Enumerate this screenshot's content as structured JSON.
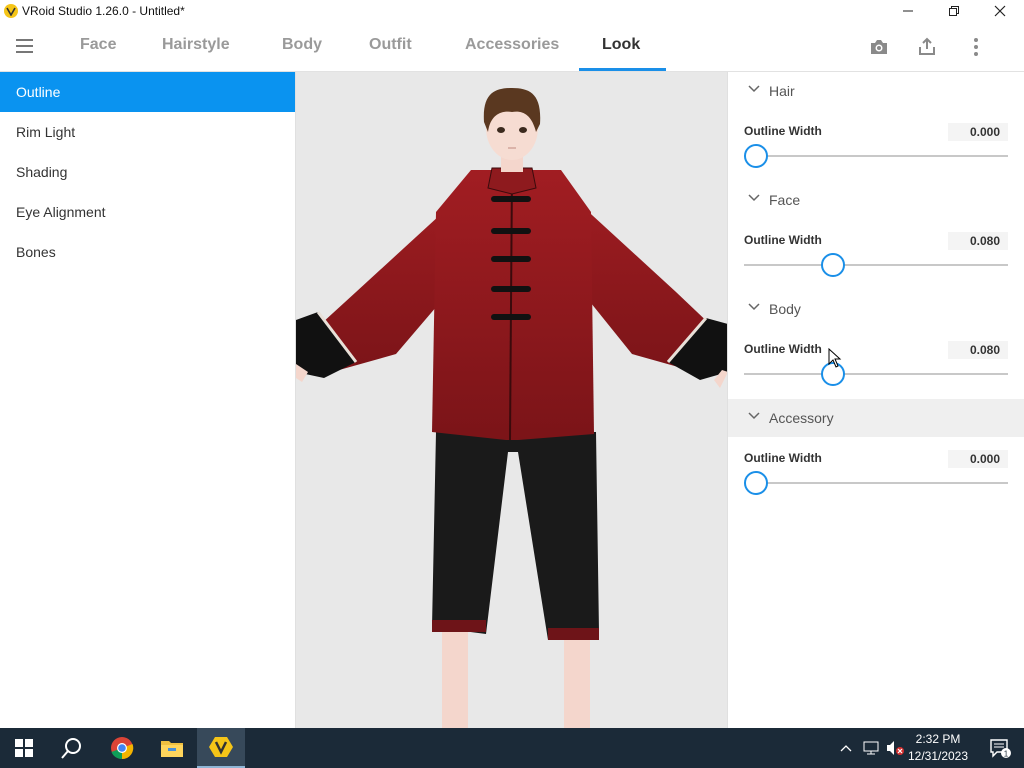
{
  "window": {
    "title": "VRoid Studio 1.26.0 - Untitled*"
  },
  "nav": {
    "tabs": [
      {
        "label": "Face"
      },
      {
        "label": "Hairstyle"
      },
      {
        "label": "Body"
      },
      {
        "label": "Outfit"
      },
      {
        "label": "Accessories"
      },
      {
        "label": "Look"
      }
    ],
    "active_tab": "Look"
  },
  "sidebar": {
    "items": [
      {
        "label": "Outline"
      },
      {
        "label": "Rim Light"
      },
      {
        "label": "Shading"
      },
      {
        "label": "Eye Alignment"
      },
      {
        "label": "Bones"
      }
    ],
    "selected": "Outline"
  },
  "panel": {
    "sections": [
      {
        "title": "Hair",
        "prop_label": "Outline Width",
        "value": "0.000",
        "slider_fraction": 0.0
      },
      {
        "title": "Face",
        "prop_label": "Outline Width",
        "value": "0.080",
        "slider_fraction": 0.3
      },
      {
        "title": "Body",
        "prop_label": "Outline Width",
        "value": "0.080",
        "slider_fraction": 0.3
      },
      {
        "title": "Accessory",
        "prop_label": "Outline Width",
        "value": "0.000",
        "slider_fraction": 0.0
      }
    ]
  },
  "taskbar": {
    "time": "2:32 PM",
    "date": "12/31/2023",
    "notification_count": "1"
  },
  "colors": {
    "accent": "#0a93f0",
    "tab_underline": "#1a8fe8",
    "taskbar": "#1b2a38",
    "viewport_bg": "#e8e8e8",
    "jacket": "#8e1a1e"
  },
  "icons": [
    "hamburger-icon",
    "camera-icon",
    "share-icon",
    "more-vert-icon",
    "minimize-icon",
    "restore-icon",
    "close-icon",
    "chevron-down-icon",
    "windows-start-icon",
    "search-icon",
    "chrome-icon",
    "file-explorer-icon",
    "vroid-icon",
    "tray-chevron-up-icon",
    "network-icon",
    "volume-muted-icon",
    "notification-icon"
  ]
}
